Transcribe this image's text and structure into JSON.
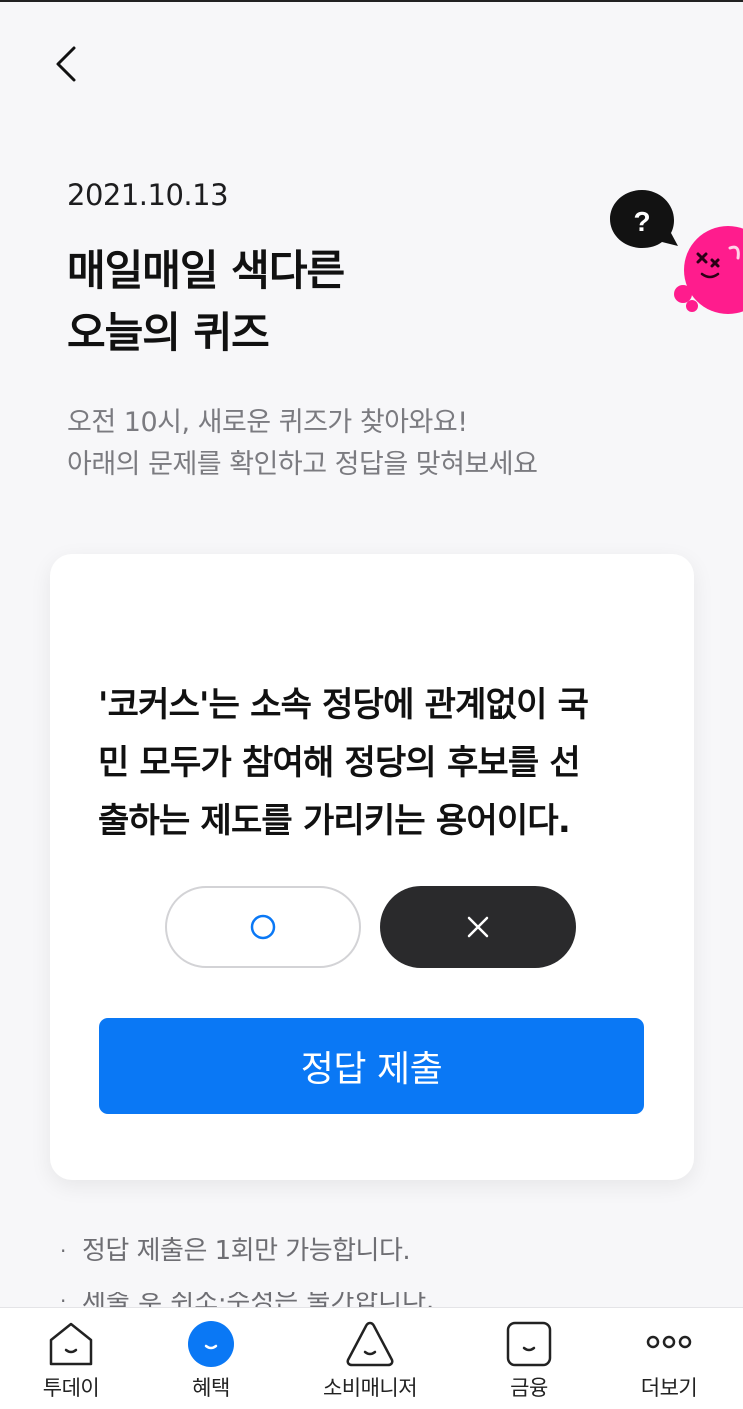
{
  "header": {
    "back_icon": "chevron-left-icon"
  },
  "hero": {
    "date": "2021.10.13",
    "title_line1": "매일매일 색다른",
    "title_line2": "오늘의 퀴즈",
    "desc_line1": "오전 10시, 새로운 퀴즈가 찾아와요!",
    "desc_line2": "아래의 문제를 확인하고 정답을 맞혀보세요",
    "mascot_bubble": "?"
  },
  "quiz": {
    "question_line1": "'코커스'는 소속 정당에 관계없이 국",
    "question_line2": "민 모두가 참여해 정당의 후보를 선",
    "question_line3": "출하는 제도를 가리키는 용어이다.",
    "option_o_icon": "circle-o-icon",
    "option_x_icon": "x-mark-icon",
    "selected": "x",
    "submit_label": "정답 제출"
  },
  "notes": [
    "정답 제출은 1회만 가능합니다.",
    "제출 후 취소·수정은 불가합니다."
  ],
  "nav": {
    "items": [
      {
        "label": "투데이",
        "icon": "house-face-icon"
      },
      {
        "label": "혜택",
        "icon": "smile-circle-icon",
        "active": true
      },
      {
        "label": "소비매니저",
        "icon": "triangle-face-icon"
      },
      {
        "label": "금융",
        "icon": "square-face-icon"
      },
      {
        "label": "더보기",
        "icon": "more-dots-icon"
      }
    ]
  },
  "colors": {
    "primary": "#0A78F5",
    "dark_button": "#2A2A2C",
    "mascot_pink": "#FF1C8D",
    "background": "#F7F7F9"
  }
}
